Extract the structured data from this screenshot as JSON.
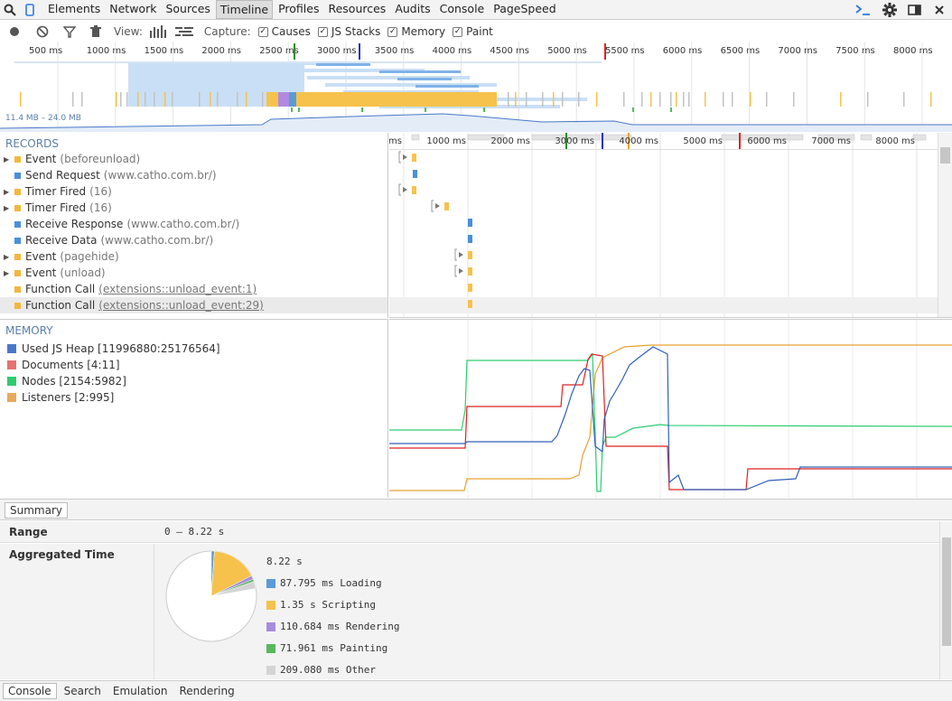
{
  "nav_tabs": [
    "Elements",
    "Network",
    "Sources",
    "Timeline",
    "Profiles",
    "Resources",
    "Audits",
    "Console",
    "PageSpeed"
  ],
  "selected_tab": "Timeline",
  "toolbar": {
    "view_label": "View:",
    "capture_label": "Capture:",
    "options": [
      {
        "label": "Causes",
        "checked": true
      },
      {
        "label": "JS Stacks",
        "checked": true
      },
      {
        "label": "Memory",
        "checked": true
      },
      {
        "label": "Paint",
        "checked": true
      }
    ]
  },
  "overview": {
    "ticks": [
      "500 ms",
      "1000 ms",
      "1500 ms",
      "2000 ms",
      "2500 ms",
      "3000 ms",
      "3500 ms",
      "4000 ms",
      "4500 ms",
      "5000 ms",
      "5500 ms",
      "6000 ms",
      "6500 ms",
      "7000 ms",
      "7500 ms",
      "8000 ms"
    ],
    "memory_range": "11.4 MB – 24.0 MB"
  },
  "records": {
    "header": "RECORDS",
    "items": [
      {
        "name": "Event",
        "detail": "(beforeunload)",
        "color": "#f5b63e",
        "expandable": true,
        "link": false
      },
      {
        "name": "Send Request",
        "detail": "(www.catho.com.br/)",
        "color": "#4a90d9",
        "expandable": false,
        "link": false
      },
      {
        "name": "Timer Fired",
        "detail": "(16)",
        "color": "#f5b63e",
        "expandable": true,
        "link": false
      },
      {
        "name": "Timer Fired",
        "detail": "(16)",
        "color": "#f5b63e",
        "expandable": true,
        "link": false
      },
      {
        "name": "Receive Response",
        "detail": "(www.catho.com.br/)",
        "color": "#4a90d9",
        "expandable": false,
        "link": false
      },
      {
        "name": "Receive Data",
        "detail": "(www.catho.com.br/)",
        "color": "#4a90d9",
        "expandable": false,
        "link": false
      },
      {
        "name": "Event",
        "detail": "(pagehide)",
        "color": "#f5b63e",
        "expandable": true,
        "link": false
      },
      {
        "name": "Event",
        "detail": "(unload)",
        "color": "#f5b63e",
        "expandable": true,
        "link": false
      },
      {
        "name": "Function Call",
        "detail": "(extensions::unload_event:1)",
        "color": "#f5b63e",
        "expandable": false,
        "link": true
      },
      {
        "name": "Function Call",
        "detail": "(extensions::unload_event:29)",
        "color": "#f5b63e",
        "expandable": false,
        "link": true
      }
    ],
    "timeline_ticks": [
      "ms",
      "1000 ms",
      "2000 ms",
      "3000 ms",
      "4000 ms",
      "5000 ms",
      "6000 ms",
      "7000 ms",
      "8000 ms"
    ]
  },
  "memory": {
    "header": "MEMORY",
    "items": [
      {
        "label": "Used JS Heap [11996880:25176564]",
        "color": "#4a78c8"
      },
      {
        "label": "Documents [4:11]",
        "color": "#e57373"
      },
      {
        "label": "Nodes [2154:5982]",
        "color": "#2ecc71"
      },
      {
        "label": "Listeners [2:995]",
        "color": "#e8a95b"
      }
    ]
  },
  "summary": {
    "tab_label": "Summary",
    "range_label": "Range",
    "range_value": "0 – 8.22 s",
    "aggregated_label": "Aggregated Time",
    "total": "8.22 s",
    "legend": [
      {
        "label": "87.795 ms Loading",
        "color": "#5b9bd5",
        "value_ms": 87.795
      },
      {
        "label": "1.35 s Scripting",
        "color": "#f6c24c",
        "value_ms": 1350
      },
      {
        "label": "110.684 ms Rendering",
        "color": "#a78bdf",
        "value_ms": 110.684
      },
      {
        "label": "71.961 ms Painting",
        "color": "#58b85c",
        "value_ms": 71.961
      },
      {
        "label": "209.080 ms Other",
        "color": "#d4d4d4",
        "value_ms": 209.08
      }
    ],
    "total_ms": 8220
  },
  "bottom_tabs": [
    "Console",
    "Search",
    "Emulation",
    "Rendering"
  ]
}
